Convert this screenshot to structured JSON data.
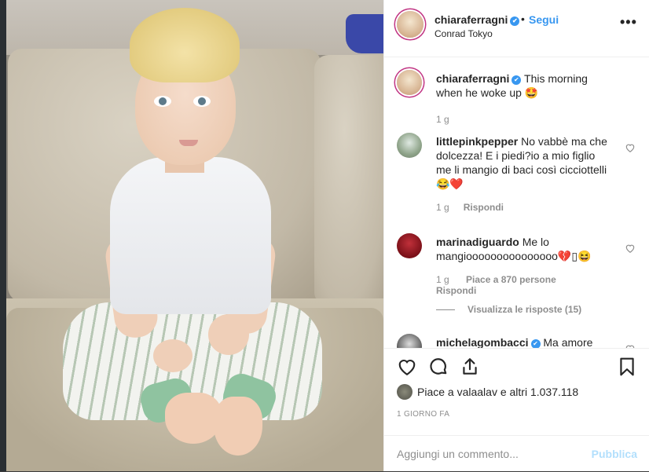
{
  "post": {
    "username": "chiaraferragni",
    "follow_label": "Segui",
    "separator": "•",
    "location": "Conrad Tokyo",
    "more_label": "•••",
    "caption_user": "chiaraferragni",
    "caption_text": "This morning when he woke up 🤩",
    "caption_time": "1 g"
  },
  "comments": [
    {
      "user": "littlepinkpepper",
      "text": "No vabbè ma che dolcezza! E i piedi?io a mio figlio me li mangio di baci così cicciottelli 😂❤️",
      "time": "1 g",
      "reply": "Rispondi"
    },
    {
      "user": "marinadiguardo",
      "text": "Me lo mangiooooooooooooooo💔▯😆",
      "time": "1 g",
      "likes": "Piace a 870 persone",
      "reply": "Rispondi",
      "view_replies": "Visualizza le risposte (15)"
    },
    {
      "user": "michelagombacci",
      "text": "Ma amore"
    }
  ],
  "footer": {
    "likes_text": "Piace a valaalav e altri 1.037.118",
    "timestamp": "1 GIORNO FA",
    "comment_placeholder": "Aggiungi un commento...",
    "post_button": "Pubblica"
  },
  "colors": {
    "accent": "#3897f0",
    "post_disabled": "#b2dffc",
    "muted": "#8e8e8e",
    "text": "#262626"
  },
  "icons": [
    "heart-icon",
    "comment-icon",
    "share-icon",
    "bookmark-icon",
    "more-icon",
    "verified-icon"
  ]
}
